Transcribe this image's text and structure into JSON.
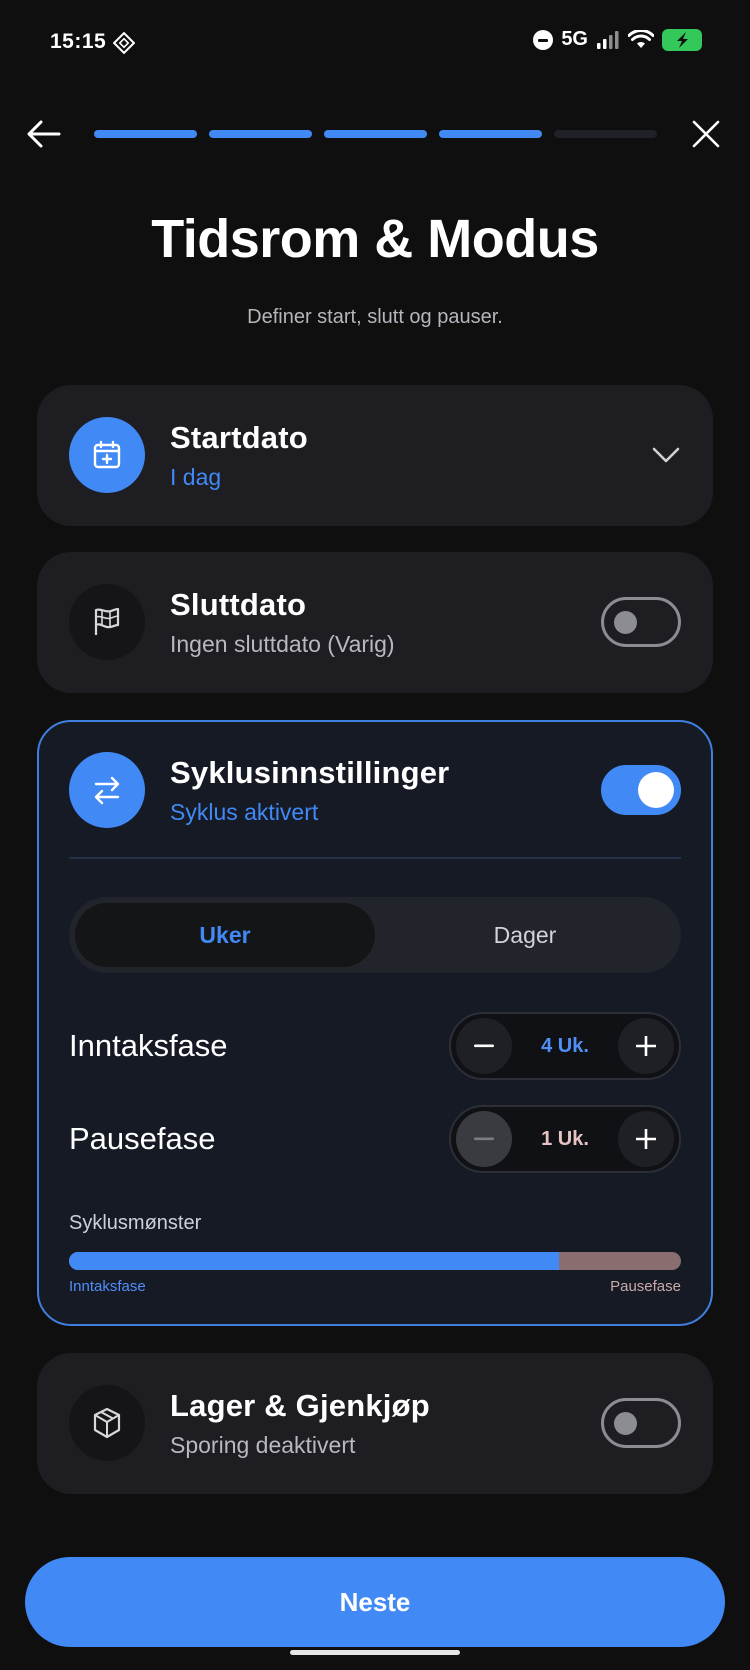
{
  "status_bar": {
    "time": "15:15",
    "network": "5G",
    "icons": [
      "app-diamond-icon",
      "do-not-disturb-icon",
      "signal-icon",
      "wifi-icon",
      "battery-charging-icon"
    ],
    "battery_color": "#34c759"
  },
  "nav": {
    "back_icon": "arrow-left-icon",
    "close_icon": "close-icon",
    "progress": {
      "completed_steps": 4,
      "total_steps": 5
    }
  },
  "page": {
    "title": "Tidsrom & Modus",
    "subtitle": "Definer start, slutt og pauser."
  },
  "start_date": {
    "title": "Startdato",
    "value": "I dag",
    "icon": "calendar-plus-icon",
    "chevron_icon": "chevron-down-icon"
  },
  "end_date": {
    "title": "Sluttdato",
    "value": "Ingen sluttdato (Varig)",
    "icon": "flag-icon",
    "enabled": false
  },
  "cycle": {
    "title": "Syklusinnstillinger",
    "status": "Syklus aktivert",
    "icon": "swap-arrows-icon",
    "enabled": true,
    "unit_tabs": [
      {
        "label": "Uker",
        "active": true
      },
      {
        "label": "Dager",
        "active": false
      }
    ],
    "intake": {
      "label": "Inntaksfase",
      "value": "4 Uk."
    },
    "pause": {
      "label": "Pausefase",
      "value": "1 Uk."
    },
    "pattern": {
      "label": "Syklusmønster",
      "intake_fraction": 0.8,
      "legend_left": "Inntaksfase",
      "legend_right": "Pausefase"
    }
  },
  "inventory": {
    "title": "Lager & Gjenkjøp",
    "status": "Sporing deaktivert",
    "icon": "package-icon",
    "enabled": false
  },
  "next_button": {
    "label": "Neste"
  },
  "colors": {
    "accent": "#4189f5",
    "background": "#0f0f10",
    "card": "#1d1d22",
    "pause": "#8a6d6e"
  }
}
